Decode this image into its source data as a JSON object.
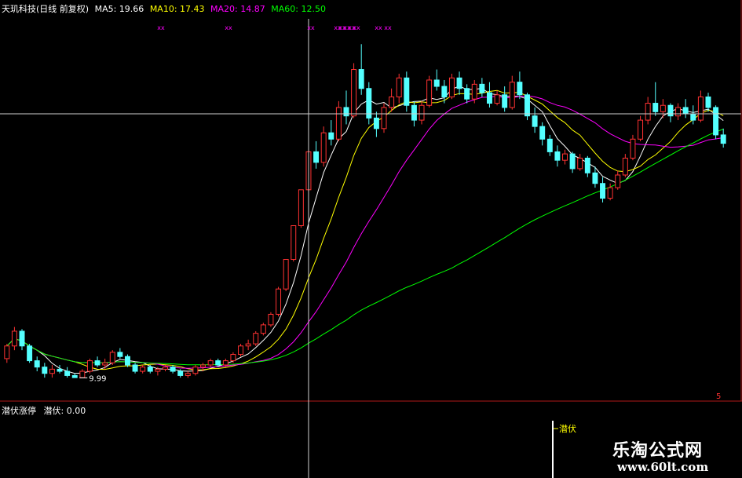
{
  "header": {
    "title": "天玑科技(日线 前复权)",
    "ma5": "MA5: 19.66",
    "ma10": "MA10: 17.43",
    "ma20": "MA20: 14.87",
    "ma60": "MA60: 12.50"
  },
  "sub_panel": {
    "title": "潜伏涨停",
    "value": "潜伏: 0.00",
    "signal_label": "潜伏"
  },
  "annotations": {
    "low_price": "9.99",
    "scale_mark": "5"
  },
  "watermark": {
    "line1": "乐淘公式网",
    "line2": "www.60lt.com"
  },
  "colors": {
    "background": "#000000",
    "up_candle": "#ff3232",
    "down_candle": "#54ffff",
    "ma5": "#ffffff",
    "ma10": "#ffff00",
    "ma20": "#ff00ff",
    "ma60": "#00ff00",
    "marker": "#ff00ff",
    "signal": "#ffff00"
  },
  "chart_data": {
    "type": "candlestick",
    "instrument": "天玑科技",
    "period": "日线 前复权",
    "price_unit": "CNY",
    "ohlc": [
      [
        10.9,
        11.6,
        10.7,
        11.5
      ],
      [
        11.5,
        12.4,
        11.3,
        12.2
      ],
      [
        12.2,
        12.3,
        11.3,
        11.5
      ],
      [
        11.5,
        11.6,
        10.7,
        10.8
      ],
      [
        10.8,
        11.0,
        10.3,
        10.5
      ],
      [
        10.5,
        10.7,
        10.0,
        10.2
      ],
      [
        10.2,
        10.6,
        10.0,
        10.4
      ],
      [
        10.4,
        10.6,
        10.2,
        10.3
      ],
      [
        10.3,
        10.5,
        10.0,
        10.1
      ],
      [
        10.1,
        10.2,
        9.99,
        10.0
      ],
      [
        10.0,
        10.4,
        9.99,
        10.3
      ],
      [
        10.3,
        10.9,
        10.2,
        10.8
      ],
      [
        10.8,
        11.0,
        10.5,
        10.6
      ],
      [
        10.6,
        10.9,
        10.4,
        10.7
      ],
      [
        10.7,
        11.3,
        10.6,
        11.2
      ],
      [
        11.2,
        11.4,
        10.9,
        11.0
      ],
      [
        11.0,
        11.1,
        10.5,
        10.6
      ],
      [
        10.6,
        10.7,
        10.2,
        10.3
      ],
      [
        10.3,
        10.6,
        10.2,
        10.5
      ],
      [
        10.5,
        10.6,
        10.2,
        10.3
      ],
      [
        10.3,
        10.5,
        10.1,
        10.4
      ],
      [
        10.4,
        10.6,
        10.3,
        10.5
      ],
      [
        10.5,
        10.6,
        10.2,
        10.3
      ],
      [
        10.3,
        10.4,
        10.0,
        10.1
      ],
      [
        10.1,
        10.3,
        9.99,
        10.2
      ],
      [
        10.2,
        10.6,
        10.1,
        10.5
      ],
      [
        10.5,
        10.7,
        10.3,
        10.6
      ],
      [
        10.6,
        10.9,
        10.5,
        10.8
      ],
      [
        10.8,
        10.9,
        10.5,
        10.6
      ],
      [
        10.6,
        10.9,
        10.5,
        10.8
      ],
      [
        10.8,
        11.2,
        10.7,
        11.1
      ],
      [
        11.1,
        11.6,
        11.0,
        11.5
      ],
      [
        11.5,
        11.8,
        11.3,
        11.6
      ],
      [
        11.6,
        12.2,
        11.5,
        12.1
      ],
      [
        12.1,
        12.6,
        12.0,
        12.5
      ],
      [
        12.5,
        13.1,
        12.4,
        13.0
      ],
      [
        13.0,
        14.3,
        12.9,
        14.2
      ],
      [
        14.2,
        15.6,
        14.1,
        15.6
      ],
      [
        15.6,
        17.2,
        15.5,
        17.2
      ],
      [
        17.2,
        18.9,
        17.1,
        18.9
      ],
      [
        18.9,
        20.8,
        18.8,
        20.7
      ],
      [
        20.7,
        21.2,
        19.9,
        20.2
      ],
      [
        20.2,
        21.9,
        20.0,
        21.6
      ],
      [
        21.6,
        22.2,
        21.0,
        21.3
      ],
      [
        21.3,
        23.1,
        21.2,
        22.8
      ],
      [
        22.8,
        23.6,
        22.0,
        22.4
      ],
      [
        22.4,
        24.9,
        22.3,
        24.6
      ],
      [
        24.6,
        25.8,
        23.4,
        23.7
      ],
      [
        23.7,
        24.0,
        22.0,
        22.3
      ],
      [
        22.3,
        22.6,
        21.4,
        21.8
      ],
      [
        21.8,
        23.0,
        21.6,
        22.8
      ],
      [
        22.8,
        23.7,
        22.6,
        23.3
      ],
      [
        23.3,
        24.4,
        23.0,
        24.2
      ],
      [
        24.2,
        24.5,
        22.6,
        22.9
      ],
      [
        22.9,
        23.1,
        21.9,
        22.2
      ],
      [
        22.2,
        23.1,
        22.0,
        22.9
      ],
      [
        22.9,
        24.3,
        22.8,
        24.1
      ],
      [
        24.1,
        24.6,
        23.6,
        23.8
      ],
      [
        23.8,
        24.1,
        23.0,
        23.3
      ],
      [
        23.3,
        24.4,
        23.2,
        24.2
      ],
      [
        24.2,
        24.5,
        23.4,
        23.7
      ],
      [
        23.7,
        23.9,
        23.0,
        23.2
      ],
      [
        23.2,
        24.1,
        23.0,
        23.9
      ],
      [
        23.9,
        24.2,
        23.3,
        23.5
      ],
      [
        23.5,
        24.0,
        22.8,
        23.0
      ],
      [
        23.0,
        23.6,
        22.9,
        23.4
      ],
      [
        23.4,
        23.8,
        22.6,
        22.8
      ],
      [
        22.8,
        24.3,
        22.7,
        24.0
      ],
      [
        24.0,
        24.5,
        23.2,
        23.4
      ],
      [
        23.4,
        23.5,
        22.2,
        22.4
      ],
      [
        22.4,
        22.8,
        21.6,
        21.9
      ],
      [
        21.9,
        22.1,
        21.0,
        21.3
      ],
      [
        21.3,
        21.5,
        20.5,
        20.7
      ],
      [
        20.7,
        21.0,
        20.0,
        20.3
      ],
      [
        20.3,
        20.8,
        20.1,
        20.6
      ],
      [
        20.6,
        20.7,
        19.7,
        19.9
      ],
      [
        19.9,
        20.6,
        19.8,
        20.4
      ],
      [
        20.4,
        20.5,
        19.5,
        19.7
      ],
      [
        19.7,
        20.0,
        19.0,
        19.2
      ],
      [
        19.2,
        19.5,
        18.3,
        18.5
      ],
      [
        18.5,
        19.2,
        18.4,
        19.0
      ],
      [
        19.0,
        19.8,
        18.9,
        19.6
      ],
      [
        19.6,
        20.6,
        19.5,
        20.4
      ],
      [
        20.4,
        21.5,
        20.3,
        21.3
      ],
      [
        21.3,
        22.4,
        21.2,
        22.2
      ],
      [
        22.2,
        23.3,
        22.0,
        23.0
      ],
      [
        23.0,
        24.0,
        22.4,
        22.6
      ],
      [
        22.6,
        23.2,
        22.3,
        22.9
      ],
      [
        22.9,
        23.0,
        22.1,
        22.4
      ],
      [
        22.4,
        23.0,
        22.2,
        22.8
      ],
      [
        22.8,
        23.2,
        22.3,
        22.5
      ],
      [
        22.5,
        22.9,
        22.0,
        22.2
      ],
      [
        22.2,
        23.6,
        22.1,
        23.3
      ],
      [
        23.3,
        23.5,
        22.6,
        22.8
      ],
      [
        22.8,
        22.9,
        21.3,
        21.5
      ],
      [
        21.5,
        21.8,
        20.9,
        21.1
      ]
    ],
    "ma_labels": [
      "MA5",
      "MA10",
      "MA20",
      "MA60"
    ],
    "markers_top": "xx",
    "crosshair": {
      "bar": 40,
      "price": 22.5
    }
  }
}
